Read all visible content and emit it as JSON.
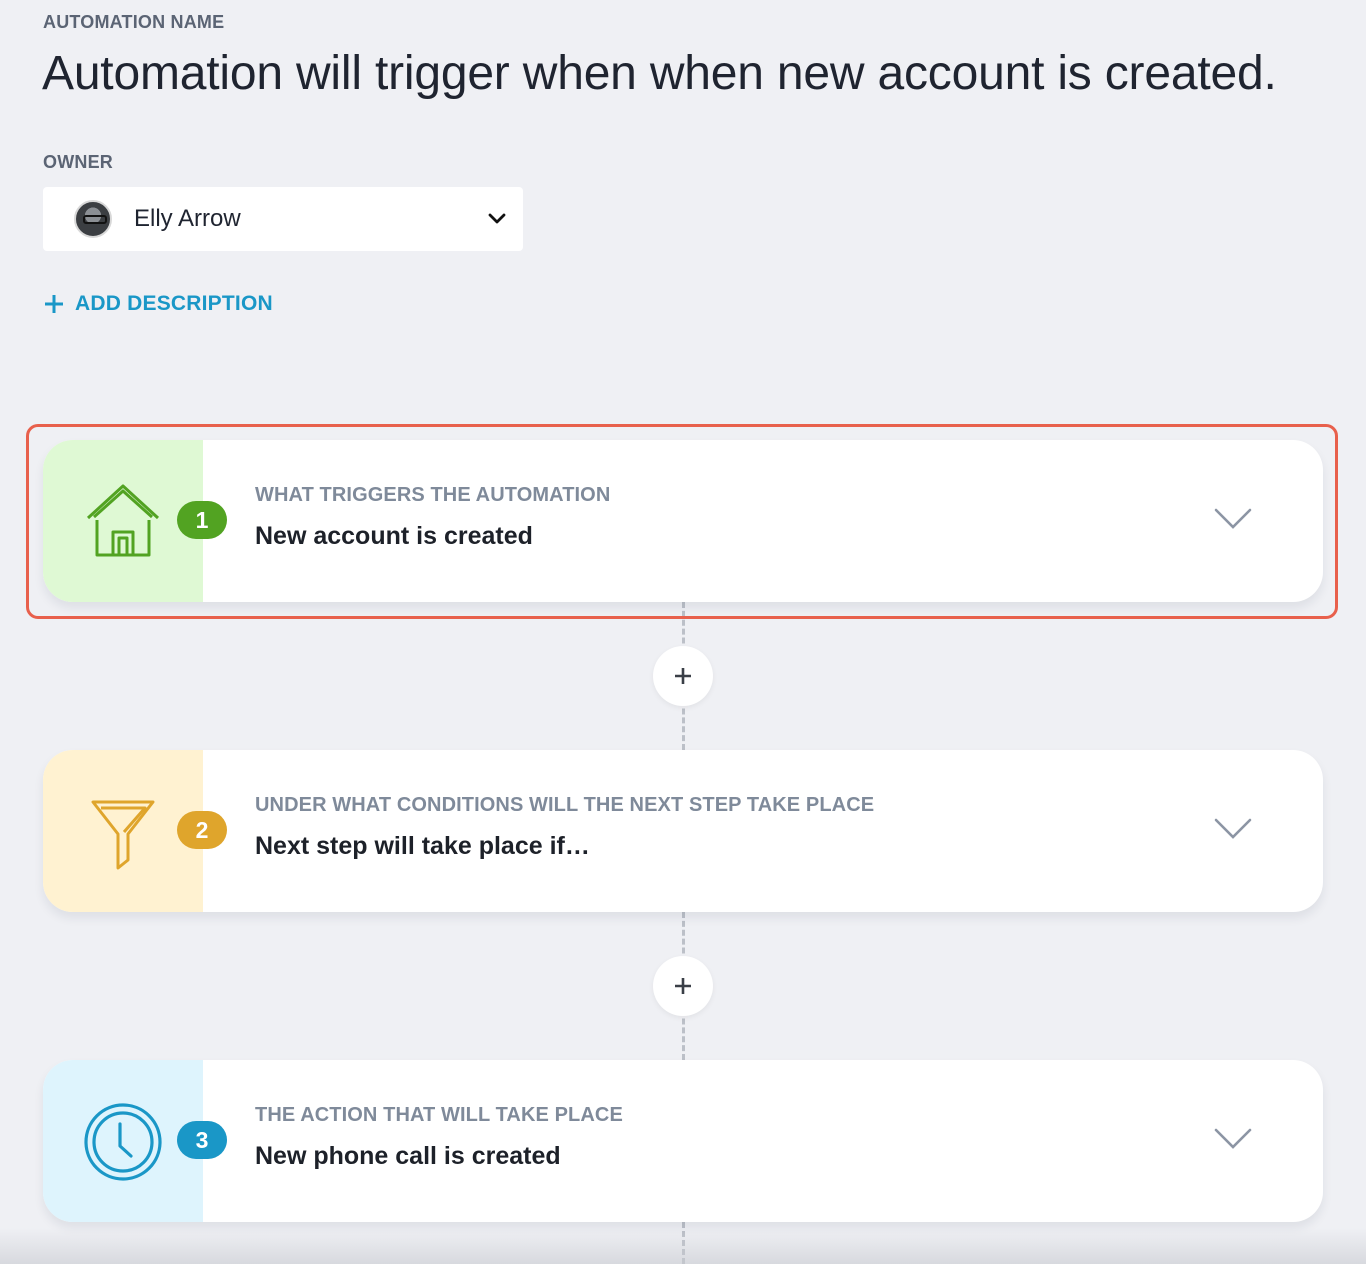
{
  "header": {
    "name_label": "AUTOMATION NAME",
    "title": "Automation will trigger when when new account is created.",
    "owner_label": "OWNER"
  },
  "owner": {
    "name": "Elly Arrow",
    "avatar_icon": "user-avatar",
    "caret_icon": "chevron-down-icon"
  },
  "description": {
    "add_label": "ADD DESCRIPTION"
  },
  "steps": [
    {
      "number": "1",
      "label": "WHAT TRIGGERS THE AUTOMATION",
      "value": "New account is created",
      "icon": "house-icon",
      "band_color": "#dff9d4",
      "accent_color": "#52a322"
    },
    {
      "number": "2",
      "label": "UNDER WHAT CONDITIONS WILL THE NEXT STEP TAKE PLACE",
      "value": "Next step will take place if…",
      "icon": "filter-icon",
      "band_color": "#fff2d1",
      "accent_color": "#dfa52c"
    },
    {
      "number": "3",
      "label": "THE ACTION THAT WILL TAKE PLACE",
      "value": "New phone call is created",
      "icon": "clock-icon",
      "band_color": "#def4fd",
      "accent_color": "#1a97c7"
    }
  ],
  "colors": {
    "background": "#eff0f4",
    "link": "#1a97c7",
    "highlight": "#e8604c"
  }
}
